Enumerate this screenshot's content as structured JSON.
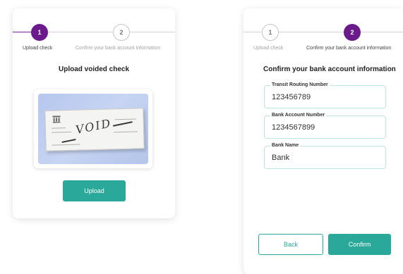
{
  "left_card": {
    "stepper": {
      "step1": {
        "number": "1",
        "label": "Upload check"
      },
      "step2": {
        "number": "2",
        "label": "Confirm your bank account information"
      }
    },
    "title": "Upload voided check",
    "check_image": {
      "void_text": "VOID"
    },
    "upload_button": "Upload"
  },
  "right_card": {
    "stepper": {
      "step1": {
        "number": "1",
        "label": "Upload check"
      },
      "step2": {
        "number": "2",
        "label": "Confirm your bank account information"
      }
    },
    "title": "Confirm your bank account information",
    "fields": [
      {
        "label": "Transit Routing Number",
        "value": "123456789"
      },
      {
        "label": "Bank Account Number",
        "value": "1234567899"
      },
      {
        "label": "Bank Name",
        "value": "Bank"
      }
    ],
    "back_button": "Back",
    "confirm_button": "Confirm"
  },
  "colors": {
    "accent_purple": "#6b1a8c",
    "accent_teal": "#2aa89a",
    "field_border": "#bfe4df"
  }
}
